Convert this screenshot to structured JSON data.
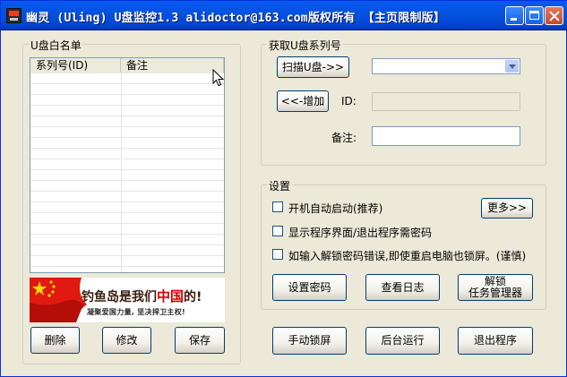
{
  "window": {
    "title": "幽灵 (Uling) U盘监控1.3    alidoctor@163.com版权所有  【主页限制版】"
  },
  "whitelist": {
    "group_label": "U盘白名单",
    "columns": [
      "系列号(ID)",
      "备注"
    ],
    "rows": [],
    "banner": {
      "main_a": "钓鱼岛是我们",
      "main_b": "中国",
      "main_c": "的!",
      "sub": "凝聚爱国力量, 坚决捍卫主权!"
    },
    "buttons": {
      "delete": "删除",
      "modify": "修改",
      "save": "保存"
    }
  },
  "serial": {
    "group_label": "获取U盘系列号",
    "scan_button": "扫描U盘->>",
    "select_value": "",
    "add_button": "<<-增加",
    "id_label": "ID:",
    "id_value": "",
    "note_label": "备注:",
    "note_value": ""
  },
  "settings": {
    "group_label": "设置",
    "checkboxes": [
      {
        "label": "开机自动启动(推荐)",
        "checked": false
      },
      {
        "label": "显示程序界面/退出程序需密码",
        "checked": false
      },
      {
        "label": "如输入解锁密码错误,即使重启电脑也锁屏。(谨慎)",
        "checked": false
      }
    ],
    "more_button": "更多>>",
    "set_password_button": "设置密码",
    "view_log_button": "查看日志",
    "unlock_tm_button_line1": "解锁",
    "unlock_tm_button_line2": "任务管理器"
  },
  "actions": {
    "manual_lock": "手动锁屏",
    "background": "后台运行",
    "exit": "退出程序"
  },
  "colors": {
    "title_bar": "#0353e0",
    "window_bg": "#ece9d8",
    "banner_red": "#d40000"
  }
}
